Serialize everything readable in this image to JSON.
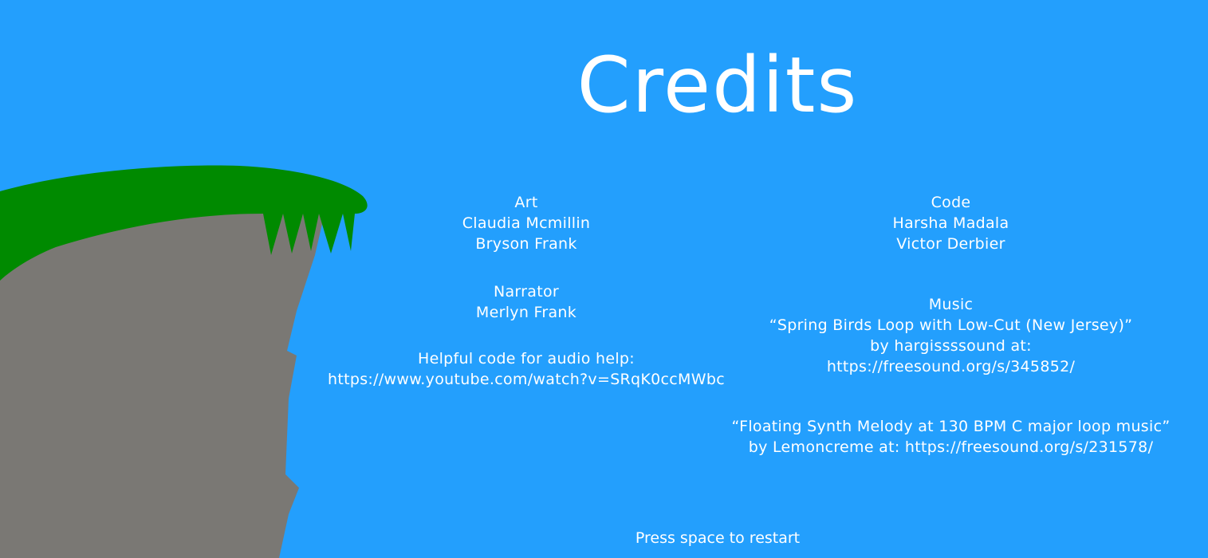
{
  "scene": {
    "background_color": "#239FFD",
    "grass_color": "#008A00",
    "rock_color": "#7A7874"
  },
  "title": "Credits",
  "art": {
    "heading": "Art",
    "names": [
      "Claudia Mcmillin",
      "Bryson Frank"
    ]
  },
  "narrator": {
    "heading": "Narrator",
    "names": [
      "Merlyn Frank"
    ]
  },
  "audio_help": {
    "heading": "Helpful code for audio help:",
    "link": "https://www.youtube.com/watch?v=SRqK0ccMWbc"
  },
  "code": {
    "heading": "Code",
    "names": [
      "Harsha Madala",
      "Victor Derbier"
    ]
  },
  "music": {
    "heading": "Music",
    "tracks": [
      {
        "lines": [
          "“Spring Birds Loop with Low-Cut (New Jersey)”",
          "by hargissssound at:",
          "https://freesound.org/s/345852/"
        ]
      },
      {
        "lines": [
          "“Floating Synth Melody at 130 BPM C major loop music”",
          "by Lemoncreme at: https://freesound.org/s/231578/"
        ]
      }
    ]
  },
  "prompt": "Press space to restart"
}
